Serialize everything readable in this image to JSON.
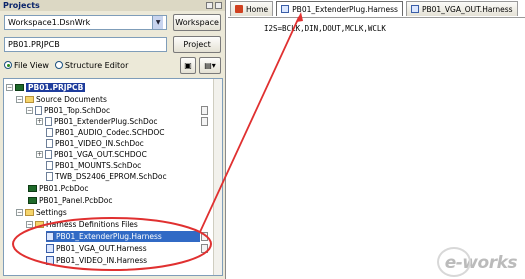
{
  "panel": {
    "title": "Projects"
  },
  "workspace": {
    "value": "Workspace1.DsnWrk",
    "button": "Workspace"
  },
  "project": {
    "value": "PB01.PRJPCB",
    "button": "Project"
  },
  "views": {
    "file_view": "File View",
    "structure_editor": "Structure Editor"
  },
  "tree": {
    "root": "PB01.PRJPCB",
    "source_documents": "Source Documents",
    "top": "PB01_Top.SchDoc",
    "items": [
      "PB01_ExtenderPlug.SchDoc",
      "PB01_AUDIO_Codec.SCHDOC",
      "PB01_VIDEO_IN.SchDoc",
      "PB01_VGA_OUT.SCHDOC",
      "PB01_MOUNTS.SchDoc",
      "TWB_DS2406_EPROM.SchDoc"
    ],
    "pcb": "PB01.PcbDoc",
    "panel_pcb": "PB01_Panel.PcbDoc",
    "settings": "Settings",
    "harness_folder": "Harness Definitions Files",
    "harness": [
      "PB01_ExtenderPlug.Harness",
      "PB01_VGA_OUT.Harness",
      "PB01_VIDEO_IN.Harness"
    ]
  },
  "tabs": [
    "Home",
    "PB01_ExtenderPlug.Harness",
    "PB01_VGA_OUT.Harness"
  ],
  "editor": {
    "code": "I2S=BCLK,DIN,DOUT,MCLK,WCLK"
  },
  "watermark": "e-works",
  "colors": {
    "highlight": "#e03030",
    "selection": "#316ac5"
  }
}
